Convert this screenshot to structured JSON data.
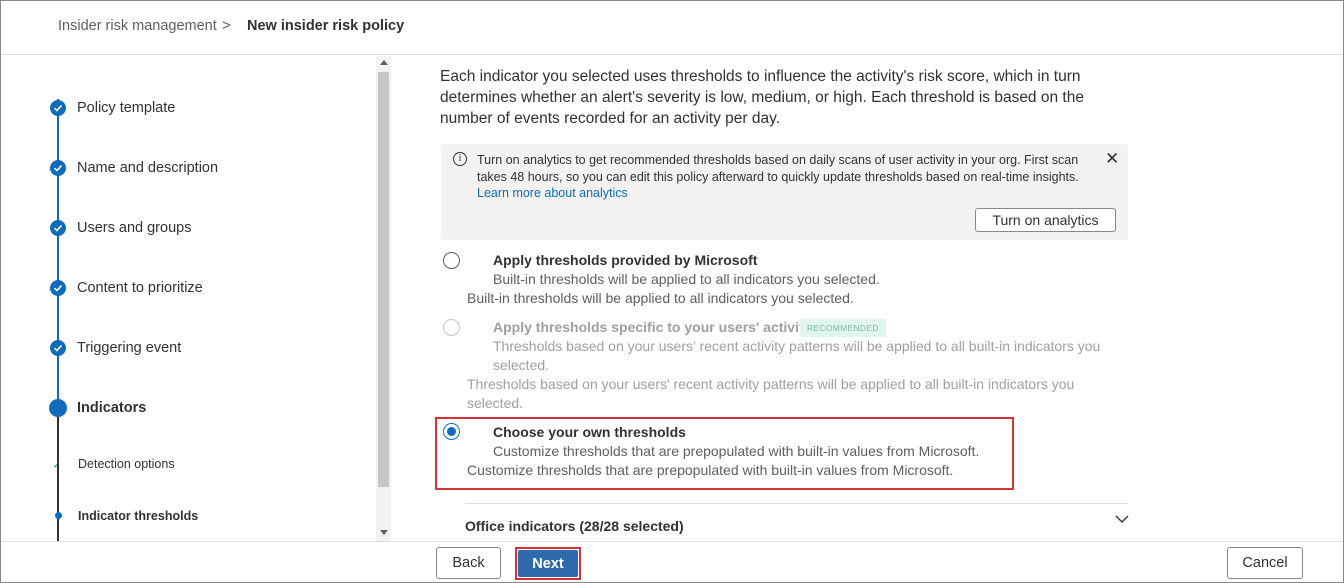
{
  "breadcrumb": {
    "parent": "Insider risk management",
    "separator": ">",
    "current": "New insider risk policy"
  },
  "steps": [
    {
      "label": "Policy template",
      "state": "complete"
    },
    {
      "label": "Name and description",
      "state": "complete"
    },
    {
      "label": "Users and groups",
      "state": "complete"
    },
    {
      "label": "Content to prioritize",
      "state": "complete"
    },
    {
      "label": "Triggering event",
      "state": "complete"
    },
    {
      "label": "Indicators",
      "state": "current"
    }
  ],
  "substeps": [
    {
      "label": "Detection options",
      "state": "complete",
      "glyph": "✓"
    },
    {
      "label": "Indicator thresholds",
      "state": "current"
    }
  ],
  "main": {
    "intro": "Each indicator you selected uses thresholds to influence the activity's risk score, which in turn determines whether an alert's severity is low, medium, or high. Each threshold is based on the number of events recorded for an activity per day.",
    "info": {
      "icon": "info-icon",
      "icon_glyph": "i",
      "text": "Turn on analytics to get recommended thresholds based on daily scans of user activity in your org. First scan takes 48 hours, so you can edit this policy afterward to quickly update thresholds based on real-time insights.",
      "link": "Learn more about analytics",
      "close_glyph": "✕",
      "button": "Turn on analytics"
    },
    "options": [
      {
        "title": "Apply thresholds provided by Microsoft",
        "description": "Built-in thresholds will be applied to all indicators you selected.",
        "selected": false,
        "disabled": false
      },
      {
        "title": "Apply thresholds specific to your users' activity",
        "badge": "RECOMMENDED",
        "description": "Thresholds based on your users' recent activity patterns will be applied to all built-in indicators you selected.",
        "selected": false,
        "disabled": true
      },
      {
        "title": "Choose your own thresholds",
        "description": "Customize thresholds that are prepopulated with built-in values from Microsoft.",
        "selected": true,
        "disabled": false
      }
    ],
    "office_indicators": "Office indicators (28/28 selected)"
  },
  "footer": {
    "back": "Back",
    "next": "Next",
    "cancel": "Cancel"
  },
  "colors": {
    "accent": "#0f6cbd",
    "primary_button": "#2f6aad",
    "highlight_border": "#d13438",
    "badge_bg": "#e0f5ee",
    "info_bg": "#f3f2f1"
  }
}
